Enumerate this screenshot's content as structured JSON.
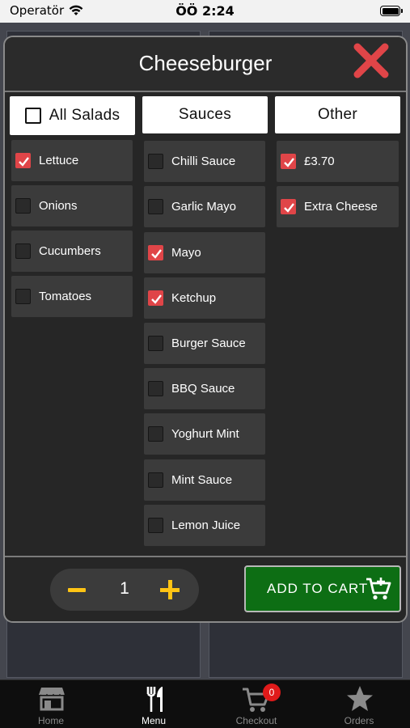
{
  "status_bar": {
    "carrier": "Operatör",
    "time": "ÖÖ 2:24"
  },
  "modal": {
    "title": "Cheeseburger",
    "columns": [
      {
        "header": "All Salads",
        "header_checkbox": true
      },
      {
        "header": "Sauces"
      },
      {
        "header": "Other"
      }
    ],
    "salads": [
      {
        "label": "Lettuce",
        "checked": true
      },
      {
        "label": "Onions",
        "checked": false
      },
      {
        "label": "Cucumbers",
        "checked": false
      },
      {
        "label": "Tomatoes",
        "checked": false
      }
    ],
    "sauces": [
      {
        "label": "Chilli Sauce",
        "checked": false
      },
      {
        "label": "Garlic Mayo",
        "checked": false
      },
      {
        "label": "Mayo",
        "checked": true
      },
      {
        "label": "Ketchup",
        "checked": true
      },
      {
        "label": "Burger Sauce",
        "checked": false
      },
      {
        "label": "BBQ Sauce",
        "checked": false
      },
      {
        "label": "Yoghurt Mint",
        "checked": false
      },
      {
        "label": "Mint Sauce",
        "checked": false
      },
      {
        "label": "Lemon Juice",
        "checked": false
      }
    ],
    "other": [
      {
        "label": "£3.70",
        "checked": true
      },
      {
        "label": "Extra Cheese",
        "checked": true
      }
    ],
    "quantity": "1",
    "add_to_cart_label": "ADD TO CART"
  },
  "tab_bar": {
    "tabs": [
      {
        "label": "Home",
        "icon": "store-icon",
        "active": false
      },
      {
        "label": "Menu",
        "icon": "cutlery-icon",
        "active": true
      },
      {
        "label": "Checkout",
        "icon": "cart-icon",
        "active": false,
        "badge": "0"
      },
      {
        "label": "Orders",
        "icon": "star-icon",
        "active": false
      }
    ]
  },
  "colors": {
    "accent_red": "#e04548",
    "cart_green": "#0d6e14",
    "stepper_yellow": "#ffc414",
    "badge_red": "#e01a1a"
  }
}
